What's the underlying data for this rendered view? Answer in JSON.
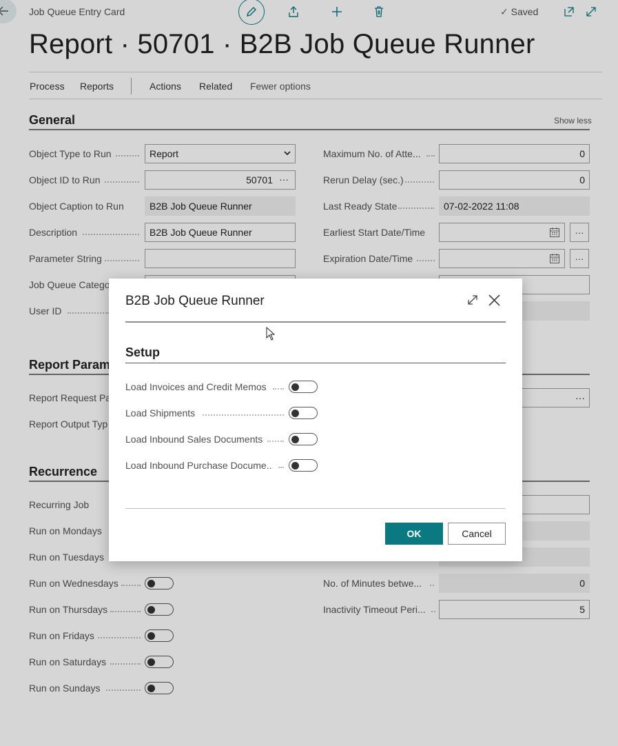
{
  "header": {
    "breadcrumb": "Job Queue Entry Card",
    "saved_label": "Saved",
    "page_title": "Report · 50701 · B2B Job Queue Runner"
  },
  "action_bar": {
    "process": "Process",
    "reports": "Reports",
    "actions": "Actions",
    "related": "Related",
    "fewer_options": "Fewer options"
  },
  "general": {
    "title": "General",
    "show_less": "Show less",
    "left_fields": [
      {
        "label": "Object Type to Run",
        "value": "Report"
      },
      {
        "label": "Object ID to Run",
        "value": "50701"
      },
      {
        "label": "Object Caption to Run",
        "value": "B2B Job Queue Runner"
      },
      {
        "label": "Description",
        "value": "B2B Job Queue Runner"
      },
      {
        "label": "Parameter String",
        "value": ""
      },
      {
        "label": "Job Queue Catego",
        "value": ""
      },
      {
        "label": "User ID",
        "value": ""
      }
    ],
    "right_fields": [
      {
        "label": "Maximum No. of Atte...",
        "value": "0"
      },
      {
        "label": "Rerun Delay (sec.)",
        "value": "0"
      },
      {
        "label": "Last Ready State",
        "value": "07-02-2022 11:08"
      },
      {
        "label": "Earliest Start Date/Time",
        "value": ""
      },
      {
        "label": "Expiration Date/Time",
        "value": ""
      }
    ]
  },
  "report_parameters": {
    "title": "Report Parame",
    "fields": [
      {
        "label": "Report Request Pag"
      },
      {
        "label": "Report Output Typ"
      }
    ]
  },
  "recurrence": {
    "title": "Recurrence",
    "left_fields": [
      {
        "label": "Recurring Job"
      },
      {
        "label": "Run on Mondays"
      },
      {
        "label": "Run on Tuesdays"
      },
      {
        "label": "Run on Wednesdays"
      },
      {
        "label": "Run on Thursdays"
      },
      {
        "label": "Run on Fridays"
      },
      {
        "label": "Run on Saturdays"
      },
      {
        "label": "Run on Sundays"
      }
    ],
    "right_fields": [
      {
        "label": "No. of Minutes betwe...",
        "value": "0"
      },
      {
        "label": "Inactivity Timeout Peri...",
        "value": "5"
      }
    ]
  },
  "dialog": {
    "title": "B2B Job Queue Runner",
    "section": "Setup",
    "options": [
      {
        "label": "Load Invoices and Credit Memos"
      },
      {
        "label": "Load Shipments"
      },
      {
        "label": "Load Inbound Sales Documents"
      },
      {
        "label": "Load Inbound Purchase Docume..."
      }
    ],
    "ok_label": "OK",
    "cancel_label": "Cancel"
  }
}
